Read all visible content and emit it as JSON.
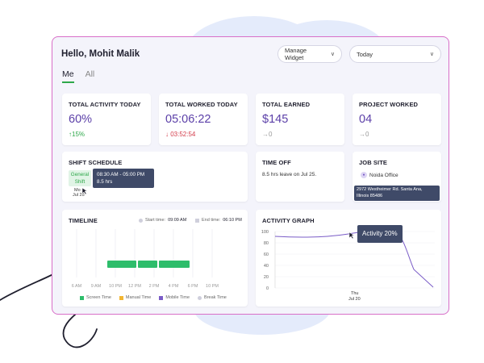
{
  "header": {
    "greeting": "Hello, Mohit Malik",
    "manage_widget": "Manage Widget",
    "date_filter": "Today"
  },
  "tabs": [
    {
      "label": "Me",
      "active": true
    },
    {
      "label": "All",
      "active": false
    }
  ],
  "stats": [
    {
      "title": "TOTAL ACTIVITY TODAY",
      "value": "60%",
      "delta": "15%",
      "trend": "up"
    },
    {
      "title": "TOTAL WORKED TODAY",
      "value": "05:06:22",
      "delta": "03:52:54",
      "trend": "down"
    },
    {
      "title": "TOTAL EARNED",
      "value": "$145",
      "delta": "0",
      "trend": "flat"
    },
    {
      "title": "PROJECT WORKED",
      "value": "04",
      "delta": "0",
      "trend": "flat"
    }
  ],
  "shift": {
    "title": "SHIFT SCHEDULE",
    "badge_line1": "General",
    "badge_line2": "Shift",
    "day": "Mo",
    "date": "Jul 25",
    "tooltip_time": "08:30 AM - 05:00 PM",
    "tooltip_hours": "8.5 hrs"
  },
  "time_off": {
    "title": "TIME OFF",
    "text": "8.5 hrs leave on Jul 25."
  },
  "job_site": {
    "title": "JOB SITE",
    "office": "Noida Office",
    "address_line1": "2972 Westheimer Rd. Santa Ana,",
    "address_line2": "Illinois 85486"
  },
  "timeline": {
    "title": "TIMELINE",
    "start_label": "Start time:",
    "start_value": "09:09 AM",
    "end_label": "End time:",
    "end_value": "06:10 PM",
    "hours": [
      "6 AM",
      "9 AM",
      "10 PM",
      "12 PM",
      "2 PM",
      "4 PM",
      "6 PM",
      "10 PM"
    ],
    "legend": [
      {
        "label": "Screen Time",
        "color": "#2ebd6b"
      },
      {
        "label": "Manual Time",
        "color": "#f2b632"
      },
      {
        "label": "Mobile Time",
        "color": "#7a5cc7"
      },
      {
        "label": "Break Time",
        "color": "#cfcfdc"
      }
    ],
    "accent": "#2ebd6b"
  },
  "activity_graph": {
    "title": "ACTIVITY GRAPH",
    "tooltip": "Activity 20%",
    "x_day": "Thu",
    "x_date": "Jul 20",
    "yticks": [
      "100",
      "80",
      "60",
      "40",
      "20",
      "0"
    ],
    "line_color": "#7a5cc7"
  }
}
